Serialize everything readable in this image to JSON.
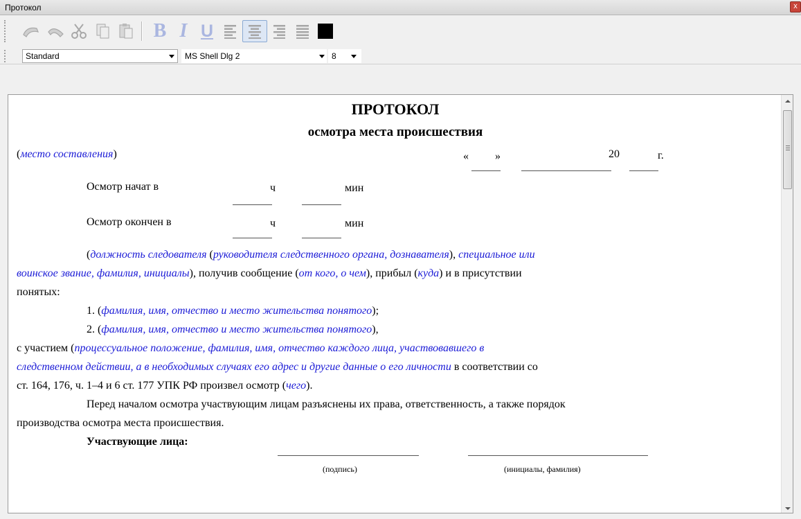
{
  "window": {
    "title": "Протокол",
    "close_glyph": "x"
  },
  "toolbar": {
    "buttons": [
      {
        "icon": "undo-icon"
      },
      {
        "icon": "redo-icon"
      },
      {
        "icon": "cut-icon"
      },
      {
        "icon": "copy-icon"
      },
      {
        "icon": "paste-icon"
      },
      {
        "icon": "bold-icon",
        "label": "B"
      },
      {
        "icon": "italic-icon",
        "label": "I"
      },
      {
        "icon": "underline-icon",
        "label": "U"
      },
      {
        "icon": "align-left-icon"
      },
      {
        "icon": "align-center-icon",
        "active": true
      },
      {
        "icon": "align-right-icon"
      },
      {
        "icon": "align-justify-icon"
      },
      {
        "icon": "text-color-icon",
        "color": "#000000"
      }
    ],
    "style_select": "Standard",
    "font_select": "MS Shell Dlg 2",
    "size_select": "8"
  },
  "document": {
    "title": "ПРОТОКОЛ",
    "subtitle": "осмотра места происшествия",
    "place": "место составления",
    "date_open_quote": "«",
    "date_close_quote": "»",
    "year_prefix": "20",
    "year_suffix": "г.",
    "start_label": "Осмотр начат в",
    "end_label": "Осмотр окончен в",
    "hour_unit": "ч",
    "min_unit": "мин",
    "p1_blue_a": "должность следователя",
    "p1_blue_b": "руководителя следственного органа, дознавателя",
    "p1_blue_c": "специальное или",
    "p2_blue_a": "воинское звание, фамилия, инициалы",
    "p2_text_a": "), получив сообщение (",
    "p2_blue_b": "от кого, о чем",
    "p2_text_b": "), прибыл (",
    "p2_blue_c": "куда",
    "p2_text_c": ") и в присутствии",
    "p3_text": "понятых:",
    "witness1_num": "1. (",
    "witness1_blue": "фамилия, имя, отчество и место жительства понятого",
    "witness1_end": ");",
    "witness2_num": "2. (",
    "witness2_blue": "фамилия, имя, отчество и место жительства понятого",
    "witness2_end": "),",
    "participation_text": "с участием  (",
    "participation_blue_a": "процессуальное положение, фамилия, имя, отчество каждого лица, участвовавшего в",
    "participation_blue_b": "следственном действии, а в необходимых случаях его адрес и другие данные о его личности",
    "participation_text_b": " в соответствии со",
    "law_text_a": "ст. 164, 176, ч. 1–4 и 6 ст. 177 УПК РФ произвел осмотр (",
    "law_blue": "чего",
    "law_text_b": ").",
    "rights_a": "Перед началом осмотра участвующим лицам разъяснены их права, ответственность, а также порядок",
    "rights_b": "производства осмотра места происшествия.",
    "participants_heading": "Участвующие лица:",
    "signature_caption": "(подпись)",
    "name_caption": "(инициалы, фамилия)"
  }
}
